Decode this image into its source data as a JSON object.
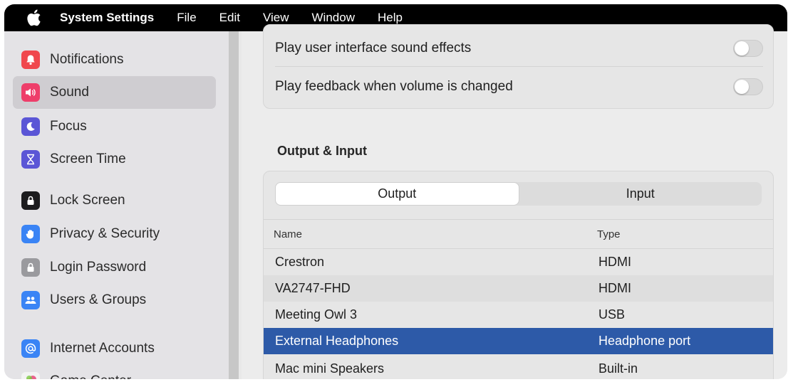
{
  "menubar": {
    "app_name": "System Settings",
    "items": [
      "File",
      "Edit",
      "View",
      "Window",
      "Help"
    ]
  },
  "sidebar": {
    "items": [
      {
        "label": "Notifications",
        "icon": "bell-icon",
        "color": "#f0474d"
      },
      {
        "label": "Sound",
        "icon": "speaker-icon",
        "color": "#ee3e6a",
        "selected": true
      },
      {
        "label": "Focus",
        "icon": "moon-icon",
        "color": "#5b56d6"
      },
      {
        "label": "Screen Time",
        "icon": "hourglass-icon",
        "color": "#5b56d6"
      },
      {
        "label": "Lock Screen",
        "icon": "lock-screen-icon",
        "color": "#1c1c1e"
      },
      {
        "label": "Privacy & Security",
        "icon": "hand-icon",
        "color": "#3a84f5"
      },
      {
        "label": "Login Password",
        "icon": "lock-icon",
        "color": "#9a9a9e"
      },
      {
        "label": "Users & Groups",
        "icon": "users-icon",
        "color": "#3a84f5"
      },
      {
        "label": "Internet Accounts",
        "icon": "at-icon",
        "color": "#3a84f5"
      },
      {
        "label": "Game Center",
        "icon": "game-center-icon",
        "color": "#f0a03c"
      }
    ]
  },
  "sound_effects": {
    "ui_sounds_label": "Play user interface sound effects",
    "ui_sounds_on": false,
    "volume_feedback_label": "Play feedback when volume is changed",
    "volume_feedback_on": false
  },
  "output_input": {
    "section_title": "Output & Input",
    "tabs": [
      "Output",
      "Input"
    ],
    "active_tab": "Output",
    "columns": {
      "name": "Name",
      "type": "Type"
    },
    "rows": [
      {
        "name": "Crestron",
        "type": "HDMI"
      },
      {
        "name": "VA2747-FHD",
        "type": "HDMI"
      },
      {
        "name": "Meeting Owl 3",
        "type": "USB"
      },
      {
        "name": "External Headphones",
        "type": "Headphone port",
        "selected": true
      },
      {
        "name": "Mac mini Speakers",
        "type": "Built-in"
      }
    ]
  },
  "colors": {
    "selection": "#2d5aa8",
    "menubar": "#000000"
  }
}
